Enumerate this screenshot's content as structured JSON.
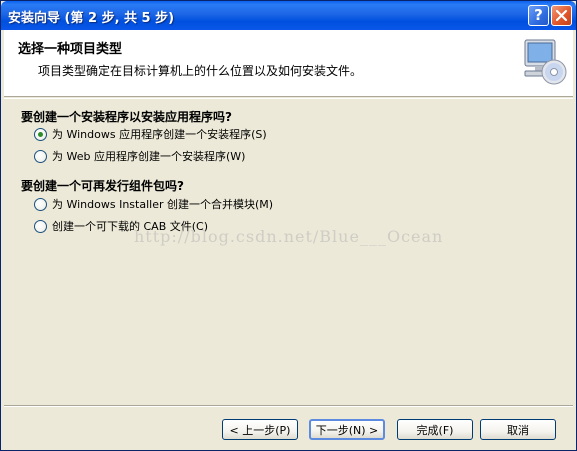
{
  "window": {
    "title": "安装向导 (第 2 步, 共 5 步)",
    "help_glyph": "?"
  },
  "header": {
    "title": "选择一种项目类型",
    "description": "项目类型确定在目标计算机上的什么位置以及如何安装文件。",
    "icon": "computer-disc-icon"
  },
  "sections": [
    {
      "title": "要创建一个安装程序以安装应用程序吗?",
      "options": [
        {
          "label": "为 Windows 应用程序创建一个安装程序(S)",
          "checked": true
        },
        {
          "label": "为 Web 应用程序创建一个安装程序(W)",
          "checked": false
        }
      ]
    },
    {
      "title": "要创建一个可再发行组件包吗?",
      "options": [
        {
          "label": "为 Windows Installer 创建一个合并模块(M)",
          "checked": false
        },
        {
          "label": "创建一个可下载的 CAB 文件(C)",
          "checked": false
        }
      ]
    }
  ],
  "watermark": "http://blog.csdn.net/Blue___Ocean",
  "buttons": {
    "back": "< 上一步(P)",
    "next": "下一步(N) >",
    "finish": "完成(F)",
    "cancel": "取消"
  },
  "colors": {
    "titlebar": "#0050df",
    "dialog_bg": "#ece9d8",
    "radio_dot": "#2c8c2a"
  }
}
